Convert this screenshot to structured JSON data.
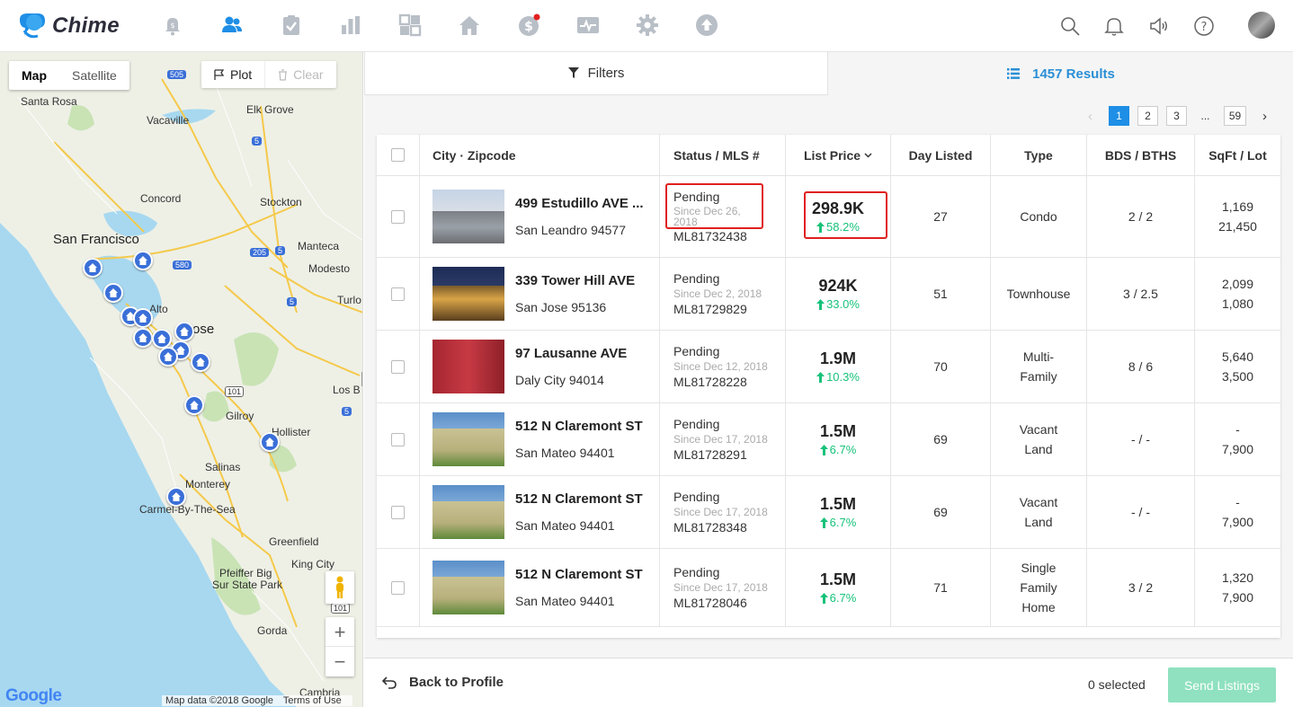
{
  "app": {
    "name": "Chime"
  },
  "colors": {
    "brand": "#1e8ee6",
    "accent_green": "#17c27a",
    "highlight": "#e0201f",
    "send_disabled": "#8fe1bf"
  },
  "nav": {
    "icons": [
      "bell-dollar-icon",
      "contacts-icon",
      "clipboard-icon",
      "bar-chart-icon",
      "dashboard-icon",
      "home-icon",
      "dollar-icon",
      "activity-icon",
      "gear-icon",
      "upload-icon"
    ],
    "right_tools": [
      "search-icon",
      "notification-bell-icon",
      "speaker-icon",
      "help-icon"
    ]
  },
  "map": {
    "toggle": {
      "map": "Map",
      "satellite": "Satellite"
    },
    "plot": "Plot",
    "clear": "Clear",
    "cities": {
      "santa_rosa": "Santa Rosa",
      "vacaville": "Vacaville",
      "elk_grove": "Elk Grove",
      "concord": "Concord",
      "stockton": "Stockton",
      "san_francisco": "San Francisco",
      "manteca": "Manteca",
      "modesto": "Modesto",
      "turlock": "Turlo",
      "palo_alto": "Alto",
      "san_jose": "ose",
      "los_banos": "Los B",
      "gilroy": "Gilroy",
      "hollister": "Hollister",
      "salinas": "Salinas",
      "monterey": "Monterey",
      "carmel": "Carmel-By-The-Sea",
      "greenfield": "Greenfield",
      "king_city": "King City",
      "pfeiffer": "Pfeiffer Big",
      "pfeiffer2": "Sur State Park",
      "gorda": "Gorda",
      "cambria": "Cambria"
    },
    "highways": {
      "h505": "505",
      "h5a": "5",
      "h5b": "5",
      "h580": "580",
      "h205": "205",
      "h5c": "5",
      "h101a": "101",
      "h5d": "5",
      "h101b": "101"
    },
    "google": "Google",
    "map_data": "Map data ©2018 Google",
    "terms": "Terms of Use",
    "zoom_in": "+",
    "zoom_out": "−"
  },
  "panel": {
    "filters_label": "Filters",
    "results_label": "1457 Results",
    "pagination": {
      "pages": [
        "1",
        "2",
        "3"
      ],
      "ellipsis": "...",
      "last": "59",
      "prev": "‹",
      "next": "›"
    },
    "columns": {
      "city": "City · Zipcode",
      "status": "Status / MLS #",
      "price": "List Price",
      "day": "Day Listed",
      "type": "Type",
      "bds": "BDS / BTHS",
      "sqft": "SqFt / Lot"
    }
  },
  "listings": [
    {
      "street": "499 Estudillo AVE ...",
      "city": "San Leandro 94577",
      "status": "Pending",
      "since": "Since Dec 26, 2018",
      "mls": "ML81732438",
      "price": "298.9K",
      "change": "58.2%",
      "day": "27",
      "type": "Condo",
      "bds": "2 / 2",
      "sqft": "1,169",
      "lot": "21,450"
    },
    {
      "street": "339 Tower Hill AVE",
      "city": "San Jose 95136",
      "status": "Pending",
      "since": "Since Dec 2, 2018",
      "mls": "ML81729829",
      "price": "924K",
      "change": "33.0%",
      "day": "51",
      "type": "Townhouse",
      "bds": "3 / 2.5",
      "sqft": "2,099",
      "lot": "1,080"
    },
    {
      "street": "97 Lausanne AVE",
      "city": "Daly City 94014",
      "status": "Pending",
      "since": "Since Dec 12, 2018",
      "mls": "ML81728228",
      "price": "1.9M",
      "change": "10.3%",
      "day": "70",
      "type": "Multi-Family",
      "bds": "8 / 6",
      "sqft": "5,640",
      "lot": "3,500"
    },
    {
      "street": "512 N Claremont ST",
      "city": "San Mateo 94401",
      "status": "Pending",
      "since": "Since Dec 17, 2018",
      "mls": "ML81728291",
      "price": "1.5M",
      "change": "6.7%",
      "day": "69",
      "type": "Vacant Land",
      "bds": "- / -",
      "sqft": "-",
      "lot": "7,900"
    },
    {
      "street": "512 N Claremont ST",
      "city": "San Mateo 94401",
      "status": "Pending",
      "since": "Since Dec 17, 2018",
      "mls": "ML81728348",
      "price": "1.5M",
      "change": "6.7%",
      "day": "69",
      "type": "Vacant Land",
      "bds": "- / -",
      "sqft": "-",
      "lot": "7,900"
    },
    {
      "street": "512 N Claremont ST",
      "city": "San Mateo 94401",
      "status": "Pending",
      "since": "Since Dec 17, 2018",
      "mls": "ML81728046",
      "price": "1.5M",
      "change": "6.7%",
      "day": "71",
      "type": "Single Family Home",
      "bds": "3 / 2",
      "sqft": "1,320",
      "lot": "7,900"
    }
  ],
  "footer": {
    "back": "Back to Profile",
    "selected": "0 selected",
    "send": "Send Listings"
  }
}
